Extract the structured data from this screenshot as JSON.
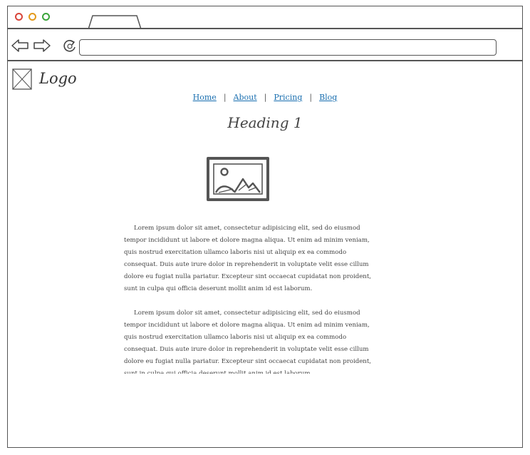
{
  "logo": {
    "text": "Logo"
  },
  "nav": {
    "links": [
      "Home",
      "About",
      "Pricing",
      "Blog"
    ],
    "separator": "|"
  },
  "heading": "Heading 1",
  "paragraphs": [
    "Lorem ipsum dolor sit amet, consectetur adipisicing elit, sed do eiusmod tempor incididunt ut labore et dolore magna aliqua. Ut enim ad minim veniam, quis nostrud exercitation ullamco laboris nisi ut aliquip ex ea commodo consequat. Duis aute irure dolor in reprehenderit in voluptate velit esse cillum dolore eu fugiat nulla pariatur. Excepteur sint occaecat cupidatat non proident, sunt in culpa qui officia deserunt mollit anim id est laborum.",
    "Lorem ipsum dolor sit amet, consectetur adipisicing elit, sed do eiusmod tempor incididunt ut labore et dolore magna aliqua. Ut enim ad minim veniam, quis nostrud exercitation ullamco laboris nisi ut aliquip ex ea commodo consequat. Duis aute irure dolor in reprehenderit in voluptate velit esse cillum dolore eu fugiat nulla pariatur. Excepteur sint occaecat cupidatat non proident, sunt in culpa qui officia deserunt mollit anim id est laborum."
  ],
  "address_bar": {
    "value": ""
  },
  "icons": {
    "window_controls": [
      "close-dot-icon",
      "minimize-dot-icon",
      "maximize-dot-icon"
    ],
    "nav": [
      "back-arrow-icon",
      "forward-arrow-icon",
      "reload-icon"
    ],
    "logo": "logo-placeholder-icon",
    "image": "image-placeholder-icon"
  },
  "colors": {
    "close": "#d9453a",
    "minimize": "#e39a1c",
    "maximize": "#3aa43a",
    "link": "#1a6fb0"
  }
}
